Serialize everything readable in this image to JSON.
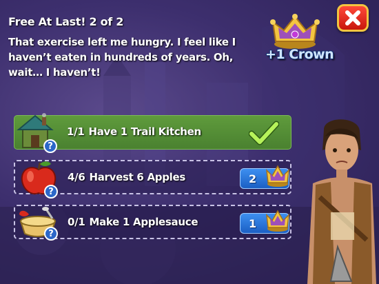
{
  "quest": {
    "title": "Free At Last! 2 of 2",
    "description": "That exercise left me hungry. I feel like I haven’t eaten in hundreds of years. Oh, wait… I haven’t!",
    "reward": "+1 Crown"
  },
  "tasks": [
    {
      "progress": "1/1",
      "label": "Have 1 Trail Kitchen",
      "completed": true,
      "icon": "trail-kitchen-icon"
    },
    {
      "progress": "4/6",
      "label": "Harvest 6 Apples",
      "completed": false,
      "skip_cost": "2",
      "icon": "apple-icon"
    },
    {
      "progress": "0/1",
      "label": "Make 1 Applesauce",
      "completed": false,
      "skip_cost": "1",
      "icon": "applesauce-icon"
    }
  ],
  "help_symbol": "?",
  "colors": {
    "complete_green": "#5f9b3c",
    "skip_blue": "#2a78de",
    "close_red": "#e0281a",
    "crown_gold": "#f3c540"
  }
}
